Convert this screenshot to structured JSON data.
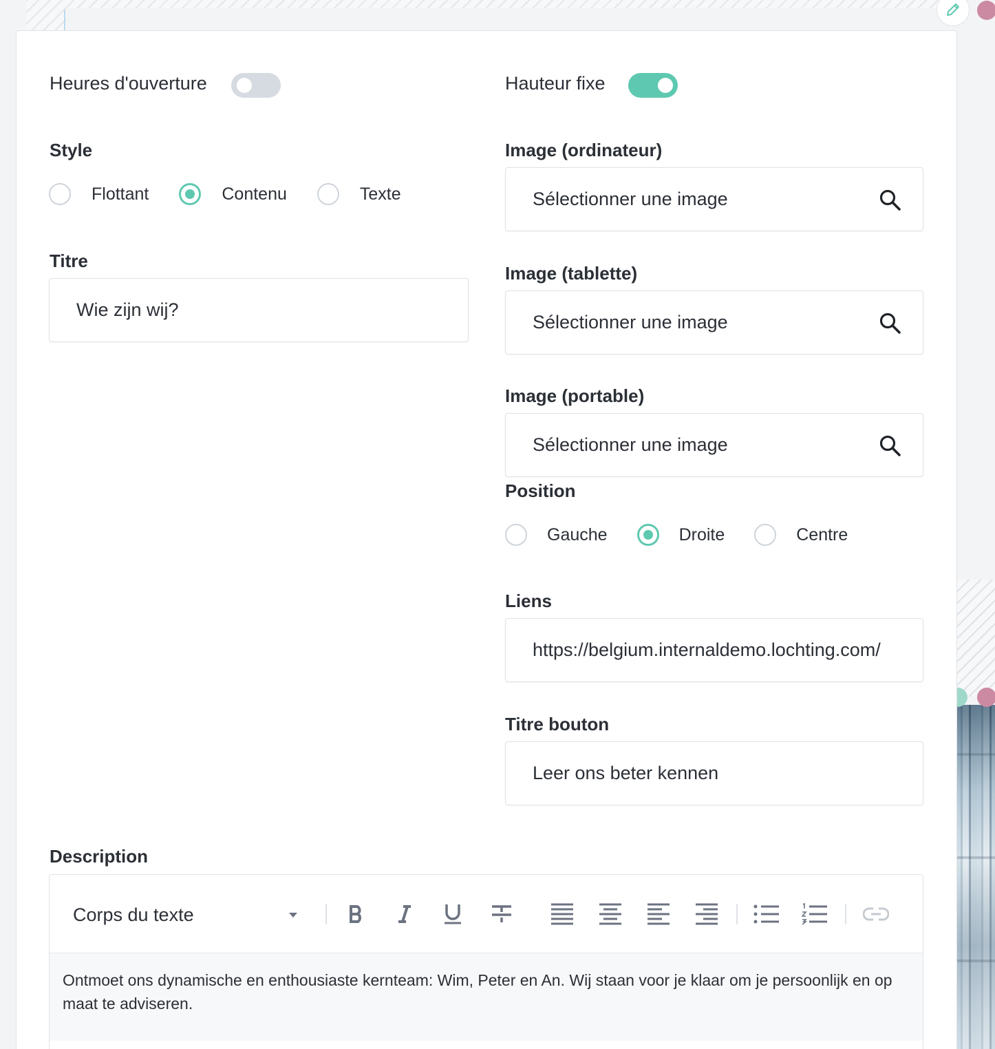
{
  "toggles": {
    "opening_hours": {
      "label": "Heures d'ouverture",
      "state": "off"
    },
    "fixed_height": {
      "label": "Hauteur fixe",
      "state": "on"
    }
  },
  "style": {
    "label": "Style",
    "options": [
      "Flottant",
      "Contenu",
      "Texte"
    ],
    "selected": "Contenu"
  },
  "title_field": {
    "label": "Titre",
    "value": "Wie zijn wij?"
  },
  "images": {
    "desktop": {
      "label": "Image (ordinateur)",
      "placeholder": "Sélectionner une image"
    },
    "tablet": {
      "label": "Image (tablette)",
      "placeholder": "Sélectionner une image"
    },
    "mobile": {
      "label": "Image (portable)",
      "placeholder": "Sélectionner une image"
    }
  },
  "position": {
    "label": "Position",
    "options": [
      "Gauche",
      "Droite",
      "Centre"
    ],
    "selected": "Droite"
  },
  "links": {
    "label": "Liens",
    "value": "https://belgium.internaldemo.lochting.com/"
  },
  "button_title": {
    "label": "Titre bouton",
    "value": "Leer ons beter kennen"
  },
  "description": {
    "label": "Description",
    "format": "Corps du texte",
    "toolbar_icons": [
      "bold-icon",
      "italic-icon",
      "underline-icon",
      "strikethrough-icon",
      "align-justify-icon",
      "align-center-icon",
      "align-left-icon",
      "align-right-icon",
      "bullet-list-icon",
      "numbered-list-icon",
      "link-icon"
    ],
    "text": "Ontmoet ons dynamische en enthousiaste kernteam: Wim, Peter en An. Wij staan voor je klaar om je persoonlijk en op maat te adviseren."
  },
  "colors": {
    "accent": "#5ec9b0",
    "toggle_off": "#d6dbe1",
    "pink_dot": "#cc8aa2"
  }
}
